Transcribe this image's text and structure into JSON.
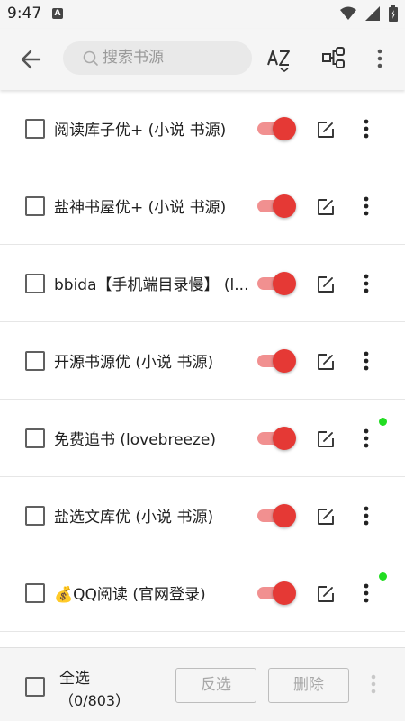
{
  "status_bar": {
    "time": "9:47",
    "notification_letter": "A"
  },
  "toolbar": {
    "search_placeholder": "搜索书源",
    "back_icon": "arrow-left-icon",
    "sort_icon": "sort-az-icon",
    "group_icon": "group-icon",
    "more_icon": "more-vertical-icon"
  },
  "sources": [
    {
      "name": "阅读库子优+ (小说 书源)",
      "checked": false,
      "enabled": true,
      "indicator": false
    },
    {
      "name": "盐神书屋优+ (小说 书源)",
      "checked": false,
      "enabled": true,
      "indicator": false
    },
    {
      "name": "bbida【手机端目录慢】 (l...",
      "checked": false,
      "enabled": true,
      "indicator": false
    },
    {
      "name": "开源书源优 (小说 书源)",
      "checked": false,
      "enabled": true,
      "indicator": false
    },
    {
      "name": "免费追书 (lovebreeze)",
      "checked": false,
      "enabled": true,
      "indicator": true
    },
    {
      "name": "盐选文库优 (小说 书源)",
      "checked": false,
      "enabled": true,
      "indicator": false
    },
    {
      "name": "💰QQ阅读 (官网登录)",
      "checked": false,
      "enabled": true,
      "indicator": true
    }
  ],
  "bottom": {
    "select_all_label": "全选",
    "selection_count": "（0/803）",
    "invert_label": "反选",
    "delete_label": "删除"
  },
  "colors": {
    "accent": "#e53935",
    "track": "#f19090",
    "indicator": "#22dd22"
  }
}
